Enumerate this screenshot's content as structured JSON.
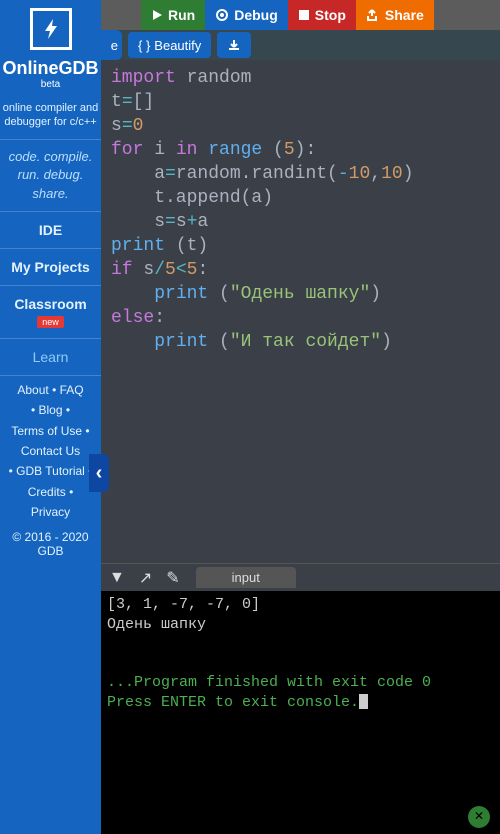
{
  "sidebar": {
    "brand": "OnlineGDB",
    "beta": "beta",
    "subtitle": "online compiler and debugger for c/c++",
    "slogan": "code. compile. run. debug. share.",
    "nav": {
      "ide": "IDE",
      "myprojects": "My Projects",
      "classroom": "Classroom",
      "newbadge": "new",
      "learn": "Learn"
    },
    "links": {
      "about": "About",
      "faq": "FAQ",
      "blog": "Blog",
      "terms": "Terms of Use",
      "contact": "Contact Us",
      "tutorial": "GDB Tutorial",
      "credits": "Credits",
      "privacy": "Privacy"
    },
    "copyright": "© 2016 - 2020 GDB"
  },
  "toolbar1": {
    "run": "Run",
    "debug": "Debug",
    "stop": "Stop",
    "share": "Share"
  },
  "toolbar2": {
    "partial": "e",
    "beautify": "Beautify"
  },
  "code": {
    "l1": {
      "a": "import",
      "b": " random"
    },
    "l2": {
      "a": "t",
      "b": "=",
      "c": "[]"
    },
    "l3": {
      "a": "s",
      "b": "=",
      "c": "0"
    },
    "l4": {
      "a": "for",
      "b": " i ",
      "c": "in",
      "d": " range ",
      "e": "(",
      "f": "5",
      "g": "):"
    },
    "l5": {
      "a": "    a",
      "b": "=",
      "c": "random.randint(",
      "d": "-",
      "e": "10",
      "f": ",",
      "g": "10",
      "h": ")"
    },
    "l6": {
      "a": "    t.append(a)"
    },
    "l7": {
      "a": "    s",
      "b": "=",
      "c": "s",
      "d": "+",
      "e": "a"
    },
    "l8": {
      "a": "print ",
      "b": "(t)"
    },
    "l9": {
      "a": "if",
      "b": " s",
      "c": "/",
      "d": "5",
      "e": "<",
      "f": "5",
      "g": ":"
    },
    "l10": {
      "a": "    ",
      "b": "print ",
      "c": "(",
      "d": "\"Одень шапку\"",
      "e": ")"
    },
    "l11": {
      "a": "else",
      "b": ":"
    },
    "l12": {
      "a": "    ",
      "b": "print ",
      "c": "(",
      "d": "\"И так сойдет\"",
      "e": ")"
    }
  },
  "console": {
    "tab_input": "input",
    "out_array": "[3, 1, -7, -7, 0]",
    "out_msg": "Одень шапку",
    "finished": "...Program finished with exit code 0",
    "press_enter": "Press ENTER to exit console."
  }
}
